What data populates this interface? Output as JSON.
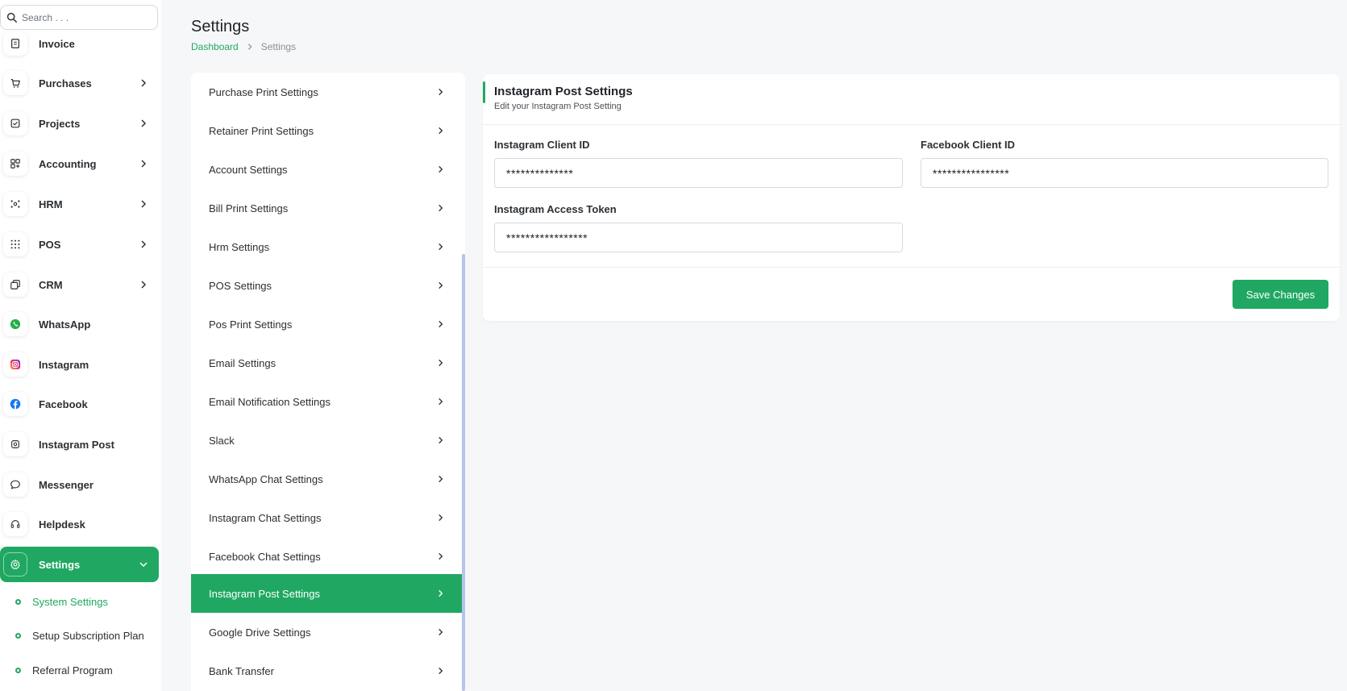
{
  "search": {
    "placeholder": "Search . . ."
  },
  "sidebar": {
    "items": [
      {
        "label": "Invoice",
        "icon": "invoice-icon",
        "has_chevron": false
      },
      {
        "label": "Purchases",
        "icon": "cart-icon",
        "has_chevron": true
      },
      {
        "label": "Projects",
        "icon": "checkbox-icon",
        "has_chevron": true
      },
      {
        "label": "Accounting",
        "icon": "grid-icon",
        "has_chevron": true
      },
      {
        "label": "HRM",
        "icon": "network-icon",
        "has_chevron": true
      },
      {
        "label": "POS",
        "icon": "dots-grid-icon",
        "has_chevron": true
      },
      {
        "label": "CRM",
        "icon": "layers-icon",
        "has_chevron": true
      },
      {
        "label": "WhatsApp",
        "icon": "whatsapp-icon",
        "has_chevron": false
      },
      {
        "label": "Instagram",
        "icon": "instagram-icon",
        "has_chevron": false
      },
      {
        "label": "Facebook",
        "icon": "facebook-icon",
        "has_chevron": false
      },
      {
        "label": "Instagram Post",
        "icon": "instagram-outline-icon",
        "has_chevron": false
      },
      {
        "label": "Messenger",
        "icon": "chat-bubble-icon",
        "has_chevron": false
      },
      {
        "label": "Helpdesk",
        "icon": "headset-icon",
        "has_chevron": false
      },
      {
        "label": "Settings",
        "icon": "gear-icon",
        "has_chevron": true,
        "active": true
      }
    ],
    "sub_items": [
      {
        "label": "System Settings",
        "current": true
      },
      {
        "label": "Setup Subscription Plan",
        "current": false
      },
      {
        "label": "Referral Program",
        "current": false
      }
    ]
  },
  "header": {
    "title": "Settings",
    "breadcrumb": {
      "home": "Dashboard",
      "current": "Settings"
    }
  },
  "settings_menu": {
    "items": [
      {
        "label": "Purchase Print Settings"
      },
      {
        "label": "Retainer Print Settings"
      },
      {
        "label": "Account Settings"
      },
      {
        "label": "Bill Print Settings"
      },
      {
        "label": "Hrm Settings"
      },
      {
        "label": "POS Settings"
      },
      {
        "label": "Pos Print Settings"
      },
      {
        "label": "Email Settings"
      },
      {
        "label": "Email Notification Settings"
      },
      {
        "label": "Slack"
      },
      {
        "label": "WhatsApp Chat Settings"
      },
      {
        "label": "Instagram Chat Settings"
      },
      {
        "label": "Facebook Chat Settings"
      },
      {
        "label": "Instagram Post Settings",
        "active": true
      },
      {
        "label": "Google Drive Settings"
      },
      {
        "label": "Bank Transfer"
      }
    ]
  },
  "card": {
    "title": "Instagram Post Settings",
    "subtitle": "Edit your Instagram Post Setting",
    "fields": {
      "instagram_client_id": {
        "label": "Instagram Client ID",
        "value": "**************"
      },
      "facebook_client_id": {
        "label": "Facebook Client ID",
        "value": "****************"
      },
      "instagram_access_token": {
        "label": "Instagram Access Token",
        "value": "*****************"
      }
    },
    "save_label": "Save Changes"
  },
  "colors": {
    "accent": "#20a862",
    "scrollbar": "#b6c4ea",
    "background": "#f6f7f8"
  }
}
